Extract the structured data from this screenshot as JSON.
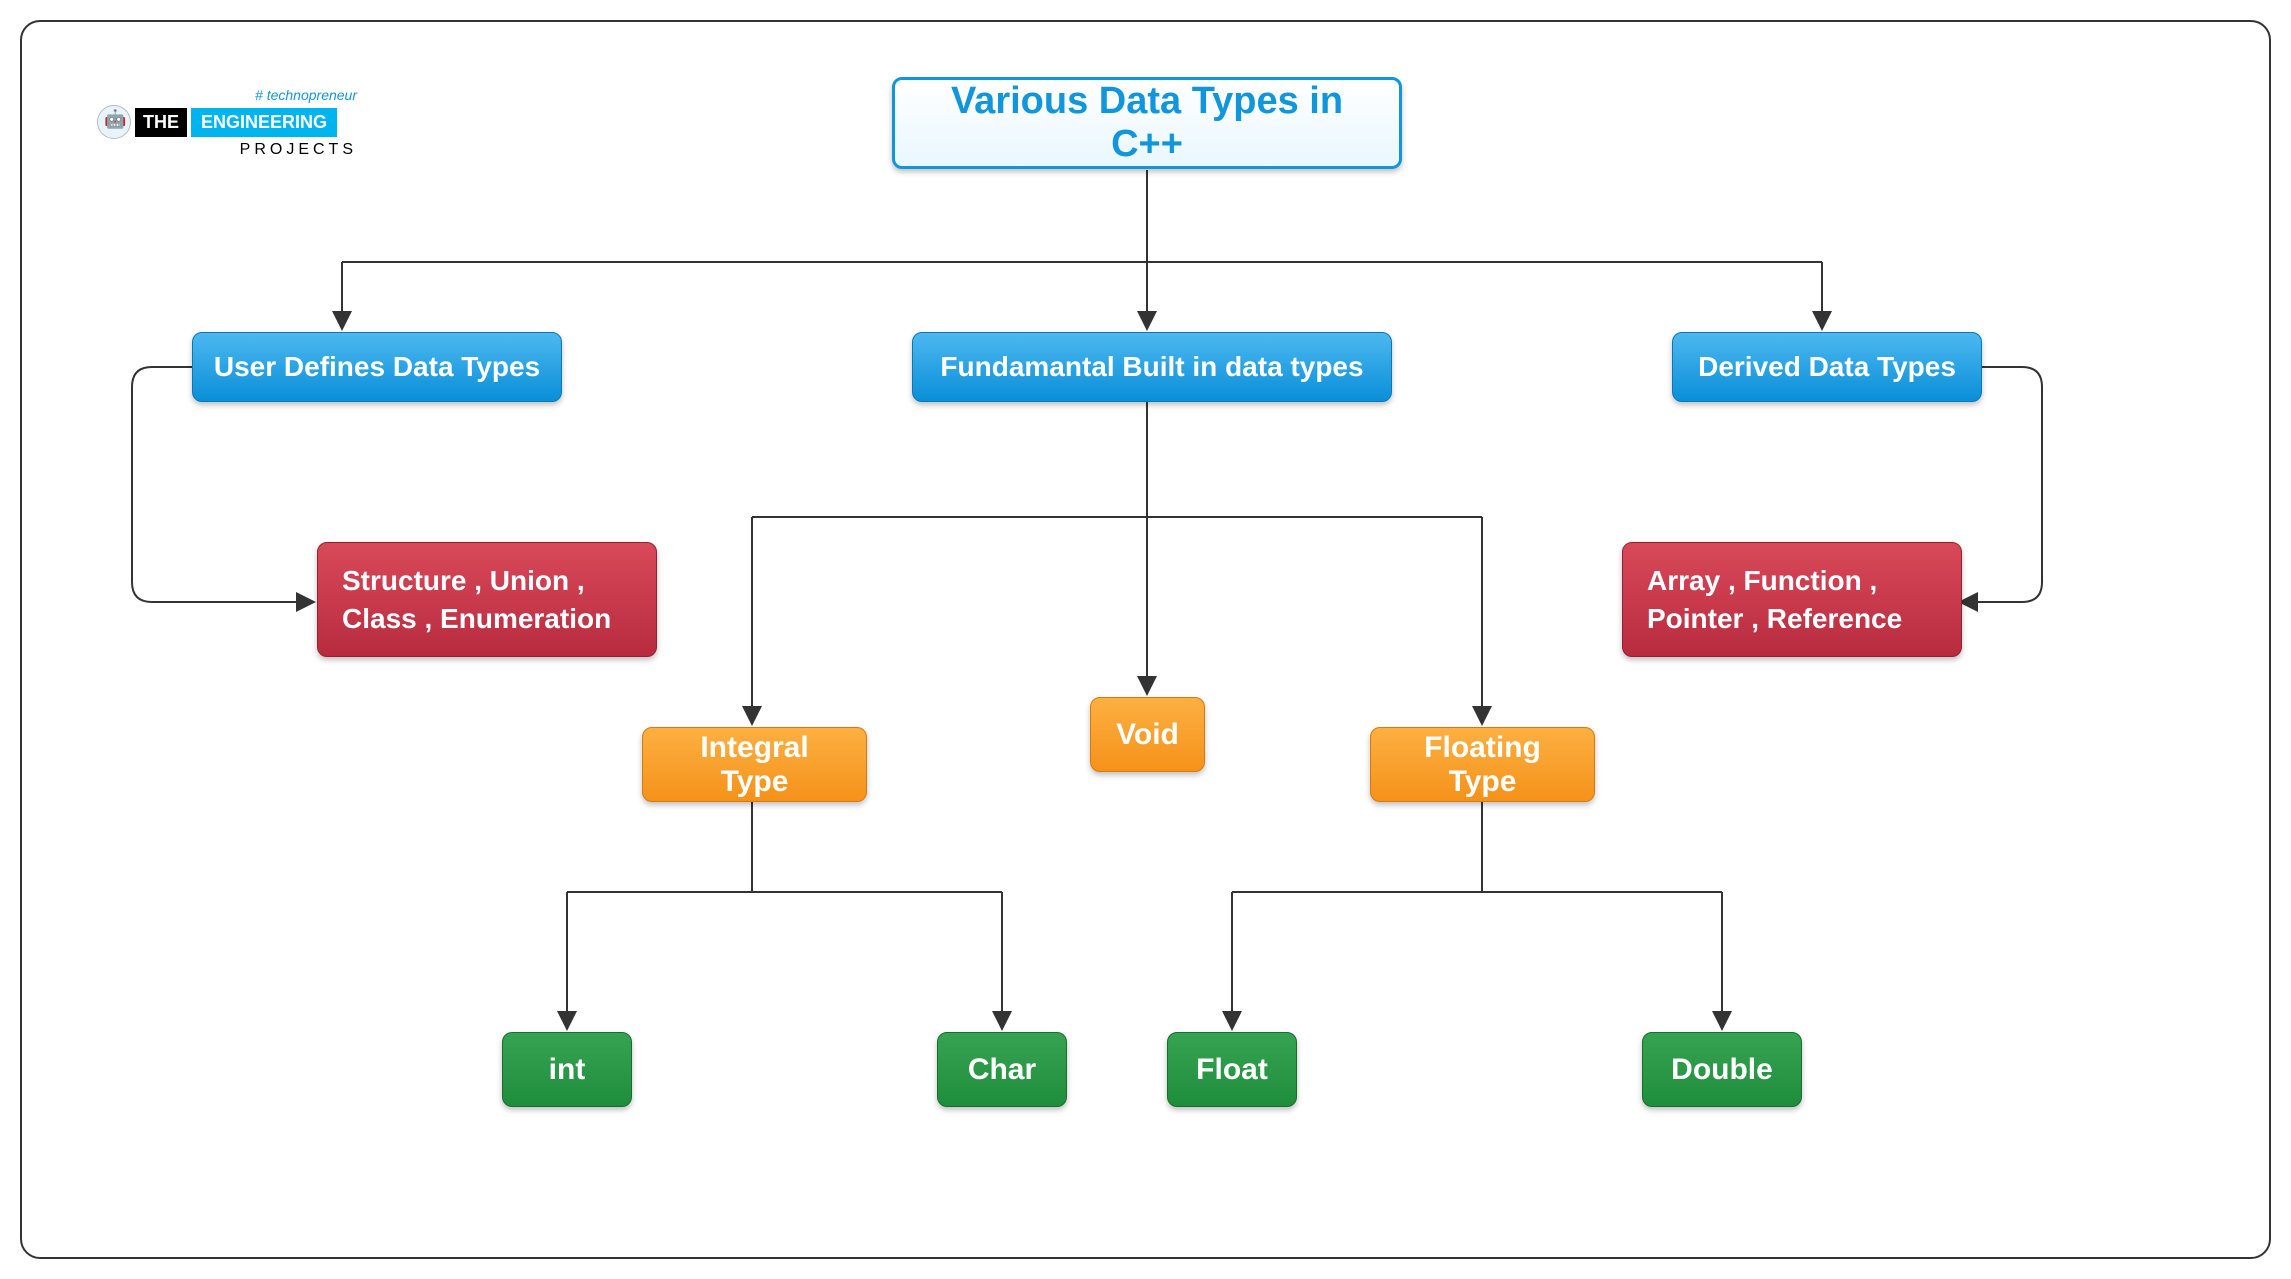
{
  "logo": {
    "tag": "# technopreneur",
    "the": "THE",
    "eng": "ENGINEERING",
    "projects": "PROJECTS"
  },
  "nodes": {
    "title": "Various Data Types in C++",
    "user": "User Defines Data Types",
    "fund": "Fundamantal Built in data types",
    "derived": "Derived Data Types",
    "user_items_l1": "Structure , Union ,",
    "user_items_l2": "Class , Enumeration",
    "derived_items_l1": "Array , Function ,",
    "derived_items_l2": "Pointer , Reference",
    "integral": "Integral Type",
    "void": "Void",
    "floating": "Floating Type",
    "int": "int",
    "char": "Char",
    "float": "Float",
    "double": "Double"
  },
  "chart_data": {
    "type": "tree",
    "title": "Various Data Types in C++",
    "root": {
      "label": "Various Data Types in C++",
      "children": [
        {
          "label": "User Defines Data Types",
          "color": "blue",
          "children": [
            {
              "label": "Structure , Union , Class , Enumeration",
              "color": "red"
            }
          ]
        },
        {
          "label": "Fundamantal Built in data types",
          "color": "blue",
          "children": [
            {
              "label": "Integral Type",
              "color": "orange",
              "children": [
                {
                  "label": "int",
                  "color": "green"
                },
                {
                  "label": "Char",
                  "color": "green"
                }
              ]
            },
            {
              "label": "Void",
              "color": "orange"
            },
            {
              "label": "Floating Type",
              "color": "orange",
              "children": [
                {
                  "label": "Float",
                  "color": "green"
                },
                {
                  "label": "Double",
                  "color": "green"
                }
              ]
            }
          ]
        },
        {
          "label": "Derived Data Types",
          "color": "blue",
          "children": [
            {
              "label": "Array , Function , Pointer , Reference",
              "color": "red"
            }
          ]
        }
      ]
    }
  }
}
